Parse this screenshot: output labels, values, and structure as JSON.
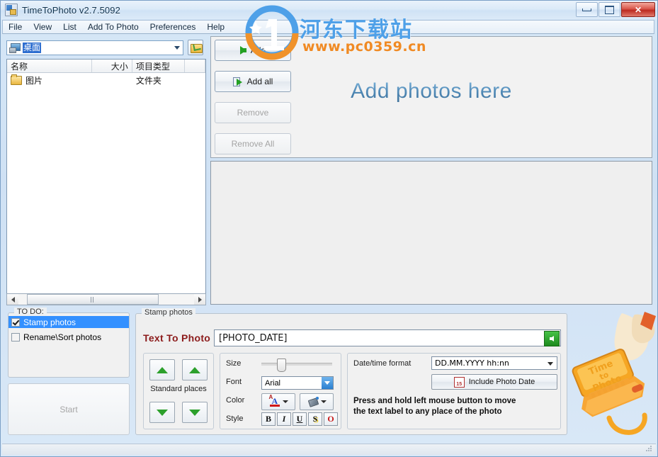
{
  "window": {
    "title": "TimeToPhoto v2.7.5092",
    "icon": "app-icon",
    "buttons": {
      "minimize": "minimize-icon",
      "maximize": "maximize-icon",
      "close": "close-icon"
    }
  },
  "menu": {
    "items": [
      {
        "label": "File"
      },
      {
        "label": "View"
      },
      {
        "label": "List"
      },
      {
        "label": "Add To Photo"
      },
      {
        "label": "Preferences"
      },
      {
        "label": "Help"
      }
    ]
  },
  "browser": {
    "path_value": "桌面",
    "browse_button_icon": "folder-open-icon",
    "columns": [
      {
        "label": "名称"
      },
      {
        "label": "大小"
      },
      {
        "label": "项目类型"
      },
      {
        "label": ""
      }
    ],
    "rows": [
      {
        "name": "图片",
        "size": "",
        "type": "文件夹",
        "extra": ""
      }
    ],
    "scrollbar": {
      "left_arrow": "scroll-left-icon",
      "right_arrow": "scroll-right-icon",
      "thumb": "scroll-thumb"
    }
  },
  "actions": {
    "add": {
      "label": "Add",
      "enabled": true
    },
    "add_all": {
      "label": "Add all",
      "enabled": true
    },
    "remove": {
      "label": "Remove",
      "enabled": false
    },
    "remove_all": {
      "label": "Remove All",
      "enabled": false
    }
  },
  "preview": {
    "drop_hint": "Add photos here"
  },
  "todo": {
    "legend": "TO DO:",
    "items": [
      {
        "label": "Stamp photos",
        "checked": true,
        "selected": true
      },
      {
        "label": "Rename\\Sort photos",
        "checked": false,
        "selected": false
      }
    ],
    "start_label": "Start",
    "start_enabled": false
  },
  "stamp": {
    "legend": "Stamp photos",
    "text_to_photo_label": "Text To Photo",
    "text_value": "[PHOTO_DATE]",
    "apply_icon": "green-back-arrow-icon",
    "standard_places_label": "Standard places",
    "places_buttons": [
      {
        "icon": "arrow-up-icon"
      },
      {
        "icon": "arrow-up-icon"
      },
      {
        "icon": "arrow-down-icon"
      },
      {
        "icon": "arrow-down-icon"
      }
    ],
    "size_label": "Size",
    "size_percent": 22,
    "font_label": "Font",
    "font_value": "Arial",
    "color_label": "Color",
    "font_color_icon": "font-color-icon",
    "fill_color_icon": "fill-color-icon",
    "style_label": "Style",
    "style_buttons": [
      {
        "label": "B",
        "name": "bold"
      },
      {
        "label": "I",
        "name": "italic"
      },
      {
        "label": "U",
        "name": "underline"
      },
      {
        "label": "S",
        "name": "shadow"
      },
      {
        "label": "O",
        "name": "outline"
      }
    ],
    "datetime_label": "Date/time format",
    "datetime_value": "DD.MM.YYYY hh:nn",
    "include_photo_date_label": "Include Photo Date",
    "include_icon": "calendar-icon",
    "calendar_day": "15",
    "hint_line1": "Press and hold left mouse button to move",
    "hint_line2": "the text label to any place of the photo"
  },
  "artwork": {
    "stamp_text_line1": "Time",
    "stamp_text_line2": "to",
    "stamp_text_line3": "Photo"
  },
  "watermark": {
    "chinese": "河东下载站",
    "url": "www.pc0359.cn"
  },
  "colors": {
    "accent_blue": "#4ea0e8",
    "watermark_orange": "#f08a23",
    "selection_blue": "#3390ff",
    "label_dark_red": "#8c1b1b",
    "green": "#2ca02c"
  }
}
